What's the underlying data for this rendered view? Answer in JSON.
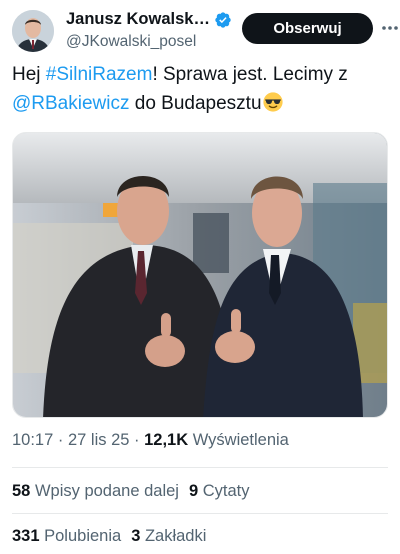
{
  "author": {
    "name": "Janusz Kowalsk…",
    "handle": "@JKowalski_posel",
    "verified": true
  },
  "follow_button": {
    "label": "Obserwuj"
  },
  "tweet": {
    "text_parts": {
      "p1": "Hej ",
      "hashtag": "#SilniRazem",
      "p2": "! Sprawa jest. Lecimy z ",
      "mention": "@RBakiewicz",
      "p3": " do Budapesztu"
    },
    "emoji": "smiling-face-with-sunglasses"
  },
  "meta": {
    "time": "10:17",
    "sep1": " · ",
    "date": "27 lis 25",
    "sep2": " · ",
    "views_count": "12,1K",
    "views_label": " Wyświetlenia"
  },
  "stats": {
    "retweets_count": "58",
    "retweets_label": " Wpisy podane dalej",
    "quotes_count": "9",
    "quotes_label": " Cytaty",
    "likes_count": "331",
    "likes_label": " Polubienia",
    "bookmarks_count": "3",
    "bookmarks_label": " Zakładki"
  },
  "colors": {
    "link": "#1d9bf0",
    "text": "#0f1419",
    "muted": "#536471",
    "verified": "#1d9bf0",
    "button": "#0f1419"
  }
}
